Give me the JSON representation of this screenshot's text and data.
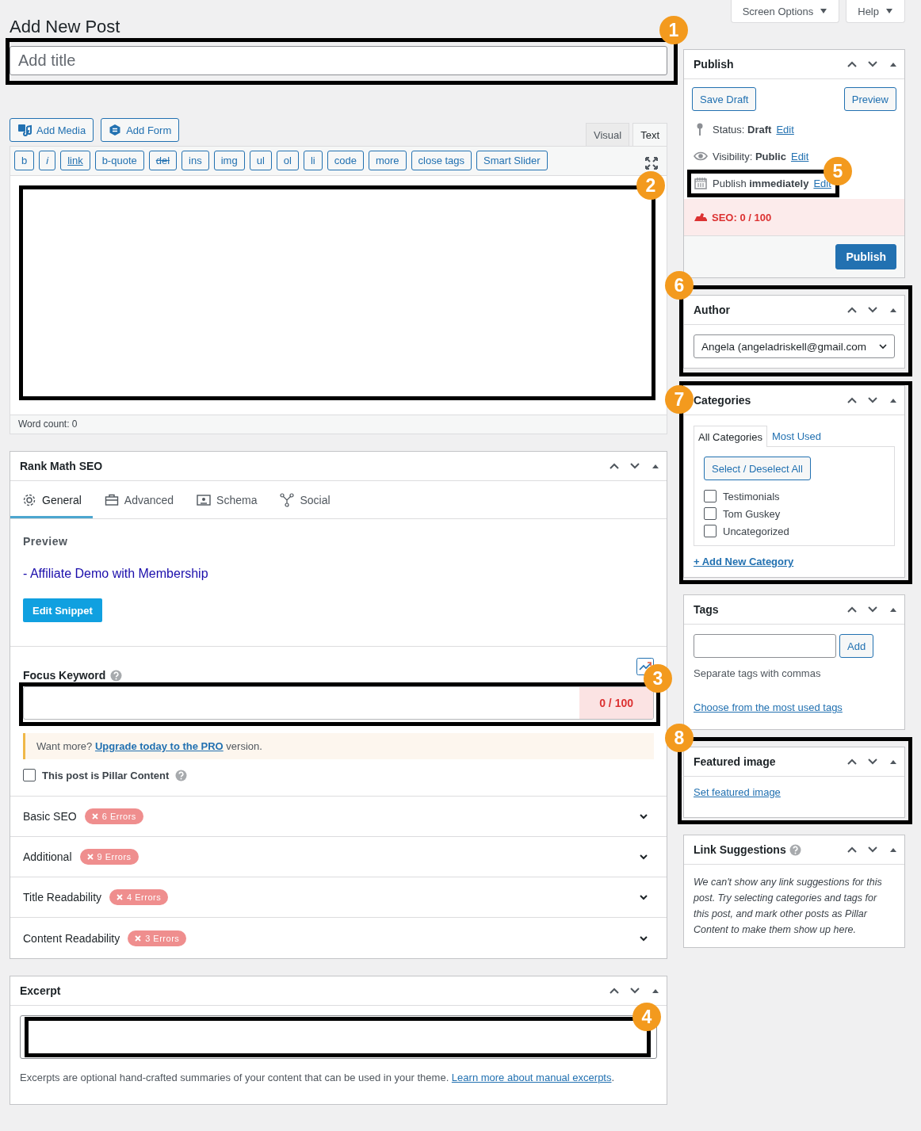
{
  "header": {
    "buttons": [
      {
        "label": "Screen Options"
      },
      {
        "label": "Help"
      }
    ]
  },
  "page_title": "Add New Post",
  "title_field": {
    "placeholder": "Add title",
    "callout": "1"
  },
  "editor": {
    "media_buttons": [
      {
        "label": "Add Media",
        "kind": "media"
      },
      {
        "label": "Add Form",
        "kind": "form"
      }
    ],
    "tabs": [
      {
        "label": "Visual",
        "selected": false
      },
      {
        "label": "Text",
        "selected": true
      }
    ],
    "quicktags": [
      {
        "label": "b",
        "kind": "plain"
      },
      {
        "label": "i",
        "kind": "italic"
      },
      {
        "label": "link",
        "kind": "underline"
      },
      {
        "label": "b-quote",
        "kind": "plain"
      },
      {
        "label": "del",
        "kind": "strike"
      },
      {
        "label": "ins",
        "kind": "plain"
      },
      {
        "label": "img",
        "kind": "plain"
      },
      {
        "label": "ul",
        "kind": "plain"
      },
      {
        "label": "ol",
        "kind": "plain"
      },
      {
        "label": "li",
        "kind": "plain"
      },
      {
        "label": "code",
        "kind": "plain"
      },
      {
        "label": "more",
        "kind": "plain"
      },
      {
        "label": "close tags",
        "kind": "plain"
      },
      {
        "label": "Smart Slider",
        "kind": "plain"
      }
    ],
    "callout": "2",
    "word_count": "Word count: 0"
  },
  "rank_math": {
    "title": "Rank Math SEO",
    "tabs": [
      {
        "label": "General",
        "kind": "gear",
        "selected": true
      },
      {
        "label": "Advanced",
        "kind": "toolbox",
        "selected": false
      },
      {
        "label": "Schema",
        "kind": "schema",
        "selected": false
      },
      {
        "label": "Social",
        "kind": "social",
        "selected": false
      }
    ],
    "preview_heading": "Preview",
    "preview_title": "- Affiliate Demo with Membership",
    "edit_snippet": "Edit Snippet",
    "focus_keyword": {
      "label": "Focus Keyword",
      "score": "0 / 100",
      "callout": "3"
    },
    "notice": {
      "before": "Want more?",
      "link": "Upgrade today to the PRO",
      "after": "version."
    },
    "pillar": {
      "label": "This post is Pillar Content",
      "checked": false
    },
    "sections": [
      {
        "title": "Basic SEO",
        "badge": "6 Errors"
      },
      {
        "title": "Additional",
        "badge": "9 Errors"
      },
      {
        "title": "Title Readability",
        "badge": "4 Errors"
      },
      {
        "title": "Content Readability",
        "badge": "3 Errors"
      }
    ]
  },
  "excerpt": {
    "title": "Excerpt",
    "callout": "4",
    "help": "Excerpts are optional hand-crafted summaries of your content that can be used in your theme.",
    "link": "Learn more about manual excerpts",
    "after": "."
  },
  "publish": {
    "title": "Publish",
    "save_draft": "Save Draft",
    "preview": "Preview",
    "rows": [
      {
        "kind": "pin",
        "label": "Status:",
        "value": "Draft",
        "link": "Edit"
      },
      {
        "kind": "eye",
        "label": "Visibility:",
        "value": "Public",
        "link": "Edit"
      },
      {
        "kind": "calendar",
        "label": "Publish",
        "value": "immediately",
        "link": "Edit",
        "callout": "5"
      }
    ],
    "seo": "SEO: 0 / 100",
    "publish_button": "Publish"
  },
  "author": {
    "title": "Author",
    "value": "Angela (angeladriskell@gmail.com",
    "callout": "6"
  },
  "categories": {
    "title": "Categories",
    "callout": "7",
    "tabs": [
      {
        "label": "All Categories",
        "selected": true
      },
      {
        "label": "Most Used",
        "selected": false
      }
    ],
    "select_all": "Select / Deselect All",
    "items": [
      {
        "label": "Testimonials",
        "checked": false
      },
      {
        "label": "Tom Guskey",
        "checked": false
      },
      {
        "label": "Uncategorized",
        "checked": false
      }
    ],
    "add_link": "+ Add New Category"
  },
  "tags": {
    "title": "Tags",
    "add": "Add",
    "hint": "Separate tags with commas",
    "link": "Choose from the most used tags"
  },
  "featured_image": {
    "title": "Featured image",
    "link": "Set featured image",
    "callout": "8"
  },
  "link_suggestions": {
    "title": "Link Suggestions",
    "text": "We can't show any link suggestions for this post. Try selecting categories and tags for this post, and mark other posts as Pillar Content to make them show up here."
  }
}
